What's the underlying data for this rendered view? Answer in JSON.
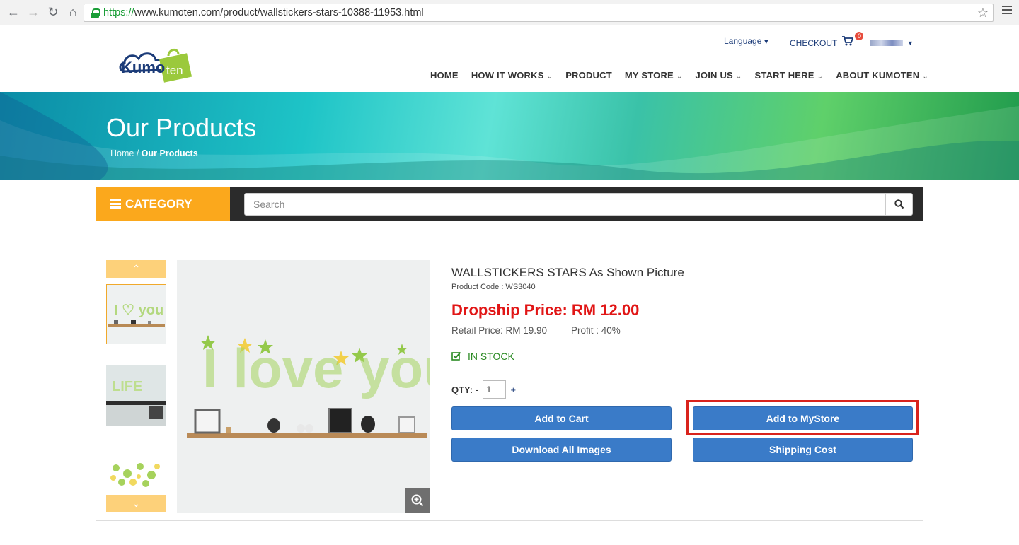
{
  "browser": {
    "url_scheme": "https://",
    "url_rest": "www.kumoten.com/product/wallstickers-stars-10388-11953.html"
  },
  "header": {
    "logo_text_kumo": "Kumo",
    "logo_text_ten": "ten",
    "language_label": "Language",
    "checkout_label": "CHECKOUT",
    "cart_count": "0",
    "nav": [
      {
        "label": "HOME",
        "dropdown": false
      },
      {
        "label": "HOW IT WORKS",
        "dropdown": true
      },
      {
        "label": "PRODUCT",
        "dropdown": false
      },
      {
        "label": "MY STORE",
        "dropdown": true
      },
      {
        "label": "JOIN US",
        "dropdown": true
      },
      {
        "label": "START HERE",
        "dropdown": true
      },
      {
        "label": "ABOUT KUMOTEN",
        "dropdown": true
      }
    ]
  },
  "banner": {
    "title": "Our Products",
    "breadcrumb_home": "Home",
    "breadcrumb_sep": "/",
    "breadcrumb_current": "Our Products"
  },
  "catbar": {
    "category_label": "CATEGORY",
    "search_placeholder": "Search"
  },
  "gallery": {
    "main_caption": "I love you"
  },
  "product": {
    "title": "WALLSTICKERS STARS As Shown Picture",
    "code": "Product Code : WS3040",
    "dropship_price": "Dropship Price: RM 12.00",
    "retail_price": "Retail Price: RM 19.90",
    "profit": "Profit : 40%",
    "stock": "IN STOCK",
    "qty_label": "QTY:",
    "qty_minus": "-",
    "qty_value": "1",
    "qty_plus": "+"
  },
  "buttons": {
    "add_to_cart": "Add to Cart",
    "add_to_mystore": "Add to MyStore",
    "download_images": "Download All Images",
    "shipping_cost": "Shipping Cost"
  },
  "colors": {
    "accent_orange": "#fba81c",
    "button_blue": "#3a7bc8",
    "price_red": "#e11616",
    "stock_green": "#2a8a22",
    "highlight_red": "#d9231c"
  }
}
